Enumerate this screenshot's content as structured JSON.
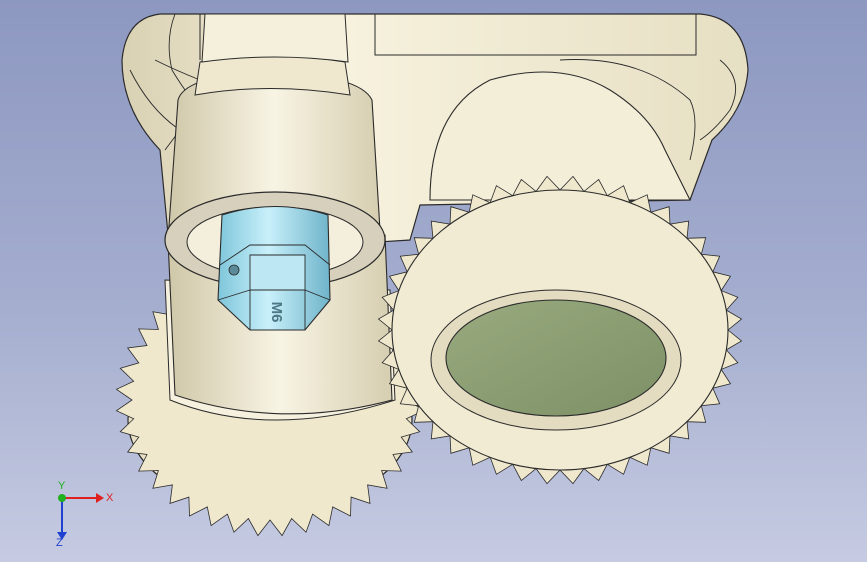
{
  "viewport": {
    "background_top": "#8d98c1",
    "background_bottom": "#c6cbe2"
  },
  "model": {
    "housing_color": "#f0ead2",
    "edge_color": "#2b2b2b",
    "nut_color": "#9fdcec",
    "nut_engraving": "M6",
    "end_face_color": "#8c9e72"
  },
  "triad": {
    "x_label": "X",
    "y_label": "Y",
    "z_label": "Z",
    "x_color": "#e02020",
    "y_color": "#20b020",
    "z_color": "#2040d0"
  }
}
